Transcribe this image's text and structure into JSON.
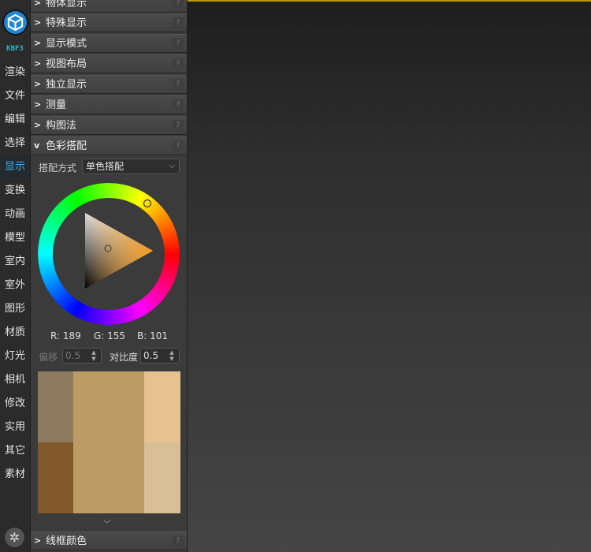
{
  "tabbar": {
    "version": "KBF3",
    "tabs": [
      "渲染",
      "文件",
      "编辑",
      "选择",
      "显示",
      "变换",
      "动画",
      "模型",
      "室内",
      "室外",
      "图形",
      "材质",
      "灯光",
      "相机",
      "修改",
      "实用",
      "其它",
      "素材"
    ],
    "active_tab": "显示"
  },
  "panel": {
    "rollouts_top": [
      {
        "label": "物体显示",
        "help": "?"
      },
      {
        "label": "特殊显示",
        "help": "?"
      },
      {
        "label": "显示模式",
        "help": "?"
      },
      {
        "label": "视图布局",
        "help": "?"
      },
      {
        "label": "独立显示",
        "help": "?"
      },
      {
        "label": "测量",
        "help": "?"
      },
      {
        "label": "构图法",
        "help": "?"
      },
      {
        "label": "色彩搭配",
        "help": "?"
      }
    ],
    "color_match": {
      "method_label": "搭配方式",
      "method_value": "单色搭配",
      "rgb": {
        "r_label": "R: 189",
        "g_label": "G: 155",
        "b_label": "B: 101"
      },
      "offset_label": "偏移",
      "offset_value": "0.5",
      "contrast_label": "对比度",
      "contrast_value": "0.5",
      "selected_color": "#bd9b65",
      "swatches": [
        "#8e7a5e",
        "#bd9b65",
        "#e6c290",
        "#80582a",
        "#d8bf95"
      ]
    },
    "rollouts_bottom": [
      {
        "label": "线框颜色",
        "help": "?"
      }
    ]
  },
  "viewport": {
    "accent": "#b8960c"
  }
}
